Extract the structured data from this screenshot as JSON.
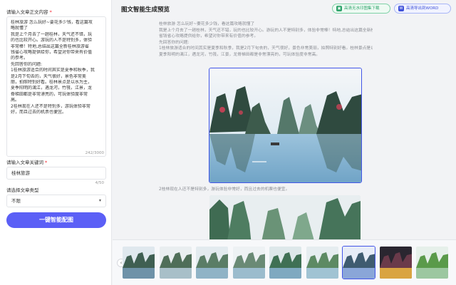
{
  "left": {
    "content_label": "请输入文章正文内容",
    "content_required": "*",
    "content_lines": [
      "桂林旅游  怎么玩好~要花多少钱，看这篇攻",
      "略就懂了",
      "我是上个月去了一趟桂林，天气还不错，玩",
      "的也比较开心。游玩的人不是特别多，体验",
      "非常棒！特地,总结出这篇全新桂林旅游省",
      "钱省心攻略提供给你，希望对你带来有价值",
      "的参考。",
      "先回答你的问题:",
      "1桂林旅游适合的时间其实是夏季和秋季，我",
      "是2月下旬去的，天气很好，景色非常美",
      "丽，拍照特别好看。桂林景点是以水为主，",
      "夏季阳明的漓江，遇龙河，竹筏，江景，龙",
      "脊梯田都是非常漂亮的，可玩体验度非常",
      "高。",
      "2桂林现在人还不是特别多，游玩体验非常",
      "好，而且过去的机票也便宜。"
    ],
    "content_counter": "242/3000",
    "keyword_label": "请输入文章关键词",
    "keyword_required": "*",
    "keyword_value": "桂林旅游",
    "keyword_counter": "4/50",
    "type_label": "请选择文章类型",
    "type_value": "不限",
    "submit_label": "一键智能配图"
  },
  "header": {
    "title": "图文智能生成预览",
    "download_label": "高清无水印图集下载",
    "export_label": "高清导出到WORD",
    "download_icon": "image-icon",
    "export_icon": "word-icon"
  },
  "preview": {
    "lines": [
      "桂林旅游  怎么玩好~要花多少钱，看这篇攻略就懂了",
      "我是上个月去了一趟桂林，天气还不错，玩的也比较开心。游玩的人不是特别多，体验非常棒！特地,总结出这篇全新桂林旅游",
      "省钱省心攻略提供给你，希望对你带来有价值的参考。",
      "先回答你的问题:",
      "1桂林旅游适合的时间其实是夏季和秋季，我是2月下旬去的，天气很好，景色非常美丽，拍照特别好看。桂林景点是以水为主，",
      "夏季阳明的漓江，遇龙河，竹筏，江景，龙脊梯田都是非常漂亮的，可玩体验度非常高。"
    ],
    "line_after_image": "2桂林现在人还不是特别多，游玩体验非常好，而且过去的机票也便宜。"
  },
  "thumbs": {
    "prev_icon": "chevron-left-icon",
    "prev_glyph": "‹",
    "count": 9,
    "active_index": 6
  },
  "colors": {
    "accent": "#5b5ff6",
    "selected_border": "#4356e8",
    "download_green": "#2fa36b",
    "export_blue": "#3f51d9",
    "required_red": "#f5222d"
  }
}
